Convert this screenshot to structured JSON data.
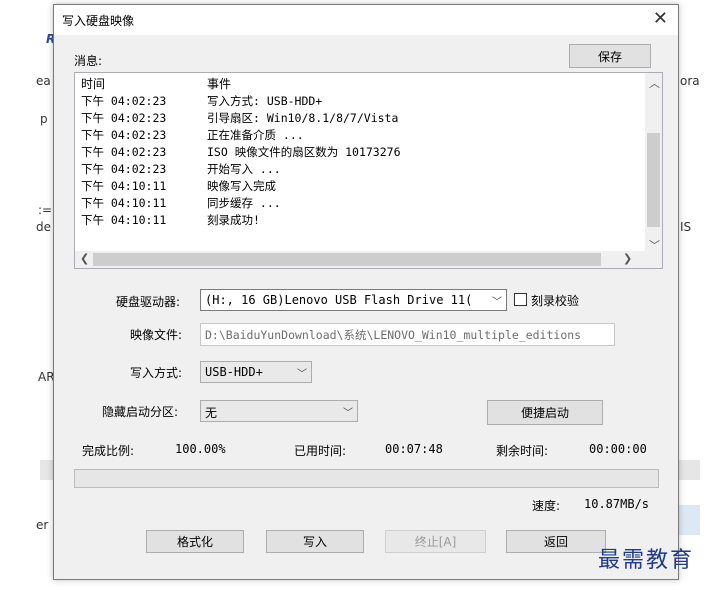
{
  "background": {
    "fragments": [
      "R",
      "ea",
      "p",
      ":=",
      "de",
      "ora",
      "IS",
      "AR",
      "er"
    ]
  },
  "dialog": {
    "title": "写入硬盘映像",
    "close_glyph": "✕",
    "messages_label": "消息:",
    "save_label": "保存",
    "log": {
      "col_time": "时间",
      "col_event": "事件",
      "rows": [
        {
          "time": "下午 04:02:23",
          "event": "写入方式: USB-HDD+"
        },
        {
          "time": "下午 04:02:23",
          "event": "引导扇区: Win10/8.1/8/7/Vista"
        },
        {
          "time": "下午 04:02:23",
          "event": "正在准备介质 ..."
        },
        {
          "time": "下午 04:02:23",
          "event": "ISO 映像文件的扇区数为 10173276"
        },
        {
          "time": "下午 04:02:23",
          "event": "开始写入 ..."
        },
        {
          "time": "下午 04:10:11",
          "event": "映像写入完成"
        },
        {
          "time": "下午 04:10:11",
          "event": "同步缓存 ..."
        },
        {
          "time": "下午 04:10:11",
          "event": "刻录成功!"
        }
      ]
    },
    "drive_label": "硬盘驱动器:",
    "drive_value": "(H:, 16 GB)Lenovo  USB Flash Drive 11(",
    "verify_label": "刻录校验",
    "image_label": "映像文件:",
    "image_value": "D:\\BaiduYunDownload\\系统\\LENOVO_Win10_multiple_editions",
    "write_mode_label": "写入方式:",
    "write_mode_value": "USB-HDD+",
    "hidden_partition_label": "隐藏启动分区:",
    "hidden_partition_value": "无",
    "quick_boot_label": "便捷启动",
    "complete_label": "完成比例:",
    "complete_value": "100.00%",
    "elapsed_label": "已用时间:",
    "elapsed_value": "00:07:48",
    "remaining_label": "剩余时间:",
    "remaining_value": "00:00:00",
    "progress_fraction": 0,
    "speed_label": "速度:",
    "speed_value": "10.87MB/s",
    "buttons": {
      "format": "格式化",
      "write": "写入",
      "abort": "终止[A]",
      "back": "返回"
    }
  },
  "watermark": "最需教育",
  "colors": {
    "progress_fill": "#06b025",
    "watermark": "#1f3a8a"
  }
}
